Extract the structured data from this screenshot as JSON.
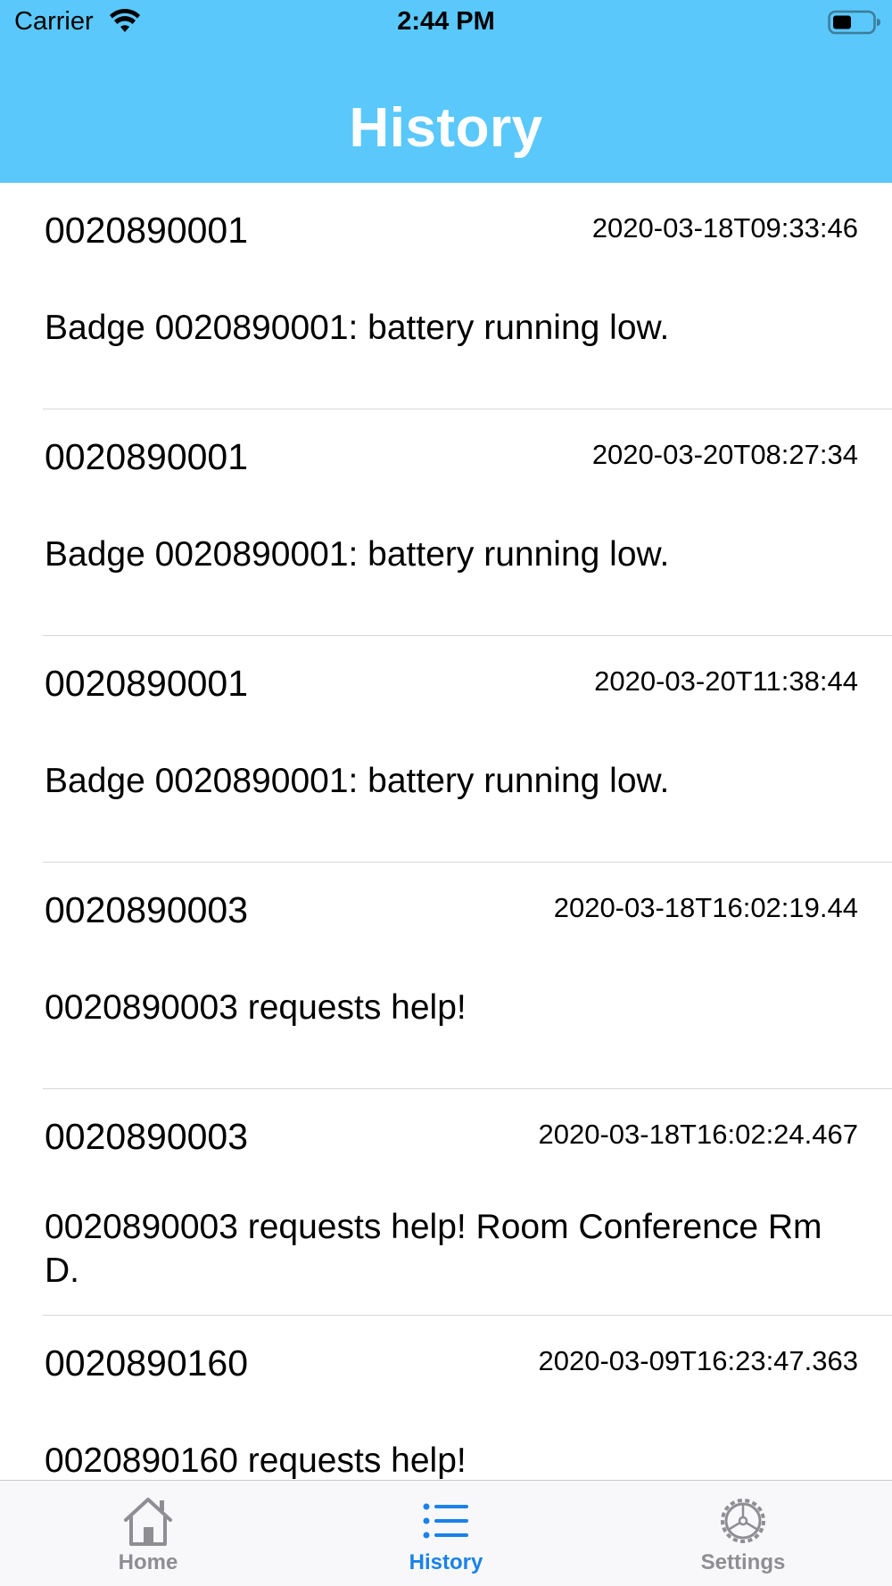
{
  "status_bar": {
    "carrier": "Carrier",
    "time": "2:44 PM",
    "wifi_icon": "wifi-icon",
    "battery_icon": "battery-icon"
  },
  "header": {
    "title": "History",
    "background_color": "#5ac8fa"
  },
  "history": [
    {
      "badge": "0020890001",
      "timestamp": "2020-03-18T09:33:46",
      "message": "Badge 0020890001: battery running low."
    },
    {
      "badge": "0020890001",
      "timestamp": "2020-03-20T08:27:34",
      "message": "Badge 0020890001: battery running low."
    },
    {
      "badge": "0020890001",
      "timestamp": "2020-03-20T11:38:44",
      "message": "Badge 0020890001: battery running low."
    },
    {
      "badge": "0020890003",
      "timestamp": "2020-03-18T16:02:19.44",
      "message": "0020890003 requests help!"
    },
    {
      "badge": "0020890003",
      "timestamp": "2020-03-18T16:02:24.467",
      "message": "0020890003 requests help!  Room Conference Rm D."
    },
    {
      "badge": "0020890160",
      "timestamp": "2020-03-09T16:23:47.363",
      "message": "0020890160 requests help!"
    }
  ],
  "tabbar": {
    "tabs": [
      {
        "label": "Home",
        "icon": "home-icon",
        "active": false
      },
      {
        "label": "History",
        "icon": "list-icon",
        "active": true
      },
      {
        "label": "Settings",
        "icon": "gear-icon",
        "active": false
      }
    ],
    "active_color": "#1a82e8",
    "inactive_color": "#8e8e93"
  }
}
